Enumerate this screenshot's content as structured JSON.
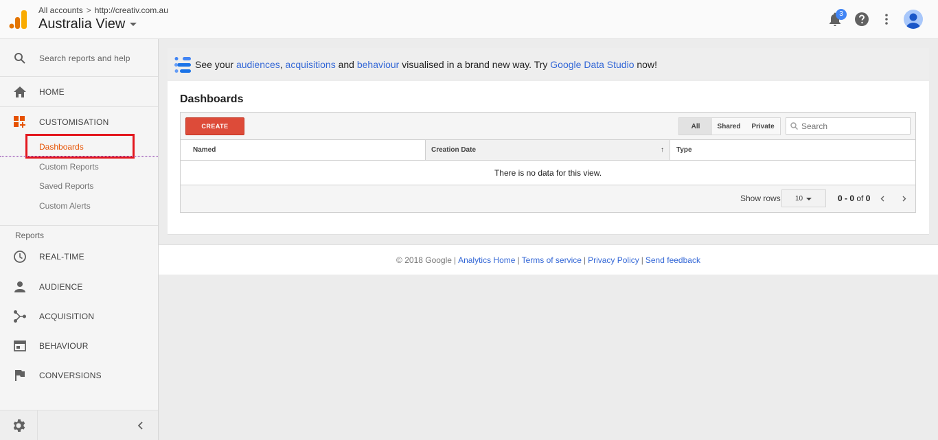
{
  "header": {
    "breadcrumb_all": "All accounts",
    "breadcrumb_sep": ">",
    "breadcrumb_property": "http://creativ.com.au",
    "view_name": "Australia View",
    "notification_count": "3",
    "icons": [
      "analytics-logo-icon",
      "bell-icon",
      "help-icon",
      "more-vert-icon",
      "avatar-icon"
    ]
  },
  "sidebar": {
    "search_placeholder": "Search reports and help",
    "home": "HOME",
    "customisation": "CUSTOMISATION",
    "customisation_items": [
      "Dashboards",
      "Custom Reports",
      "Saved Reports",
      "Custom Alerts"
    ],
    "reports_heading": "Reports",
    "reports": [
      "REAL-TIME",
      "AUDIENCE",
      "ACQUISITION",
      "BEHAVIOUR",
      "CONVERSIONS"
    ]
  },
  "banner": {
    "part1": "See your ",
    "link1": "audiences",
    "part2": ", ",
    "link2": "acquisitions",
    "part3": " and ",
    "link3": "behaviour",
    "part4": " visualised in a brand new way. Try ",
    "link4": "Google Data Studio",
    "part5": " now!"
  },
  "dashboards": {
    "title": "Dashboards",
    "create_label": "CREATE",
    "filters": [
      "All",
      "Shared",
      "Private"
    ],
    "search_placeholder": "Search",
    "columns": [
      "Named",
      "Creation Date",
      "Type"
    ],
    "sort_arrow": "↑",
    "empty_message": "There is no data for this view.",
    "show_rows_label": "Show rows",
    "rows_value": "10",
    "range_start": "0 - 0",
    "range_of": " of ",
    "range_total": "0"
  },
  "footer": {
    "copyright": "© 2018 Google",
    "links": [
      "Analytics Home",
      "Terms of service",
      "Privacy Policy",
      "Send feedback"
    ],
    "separator": "|"
  },
  "colors": {
    "accent_orange": "#e65100",
    "create_red": "#dd4b39",
    "link_blue": "#3367d6",
    "highlight_red": "#e3161d"
  }
}
